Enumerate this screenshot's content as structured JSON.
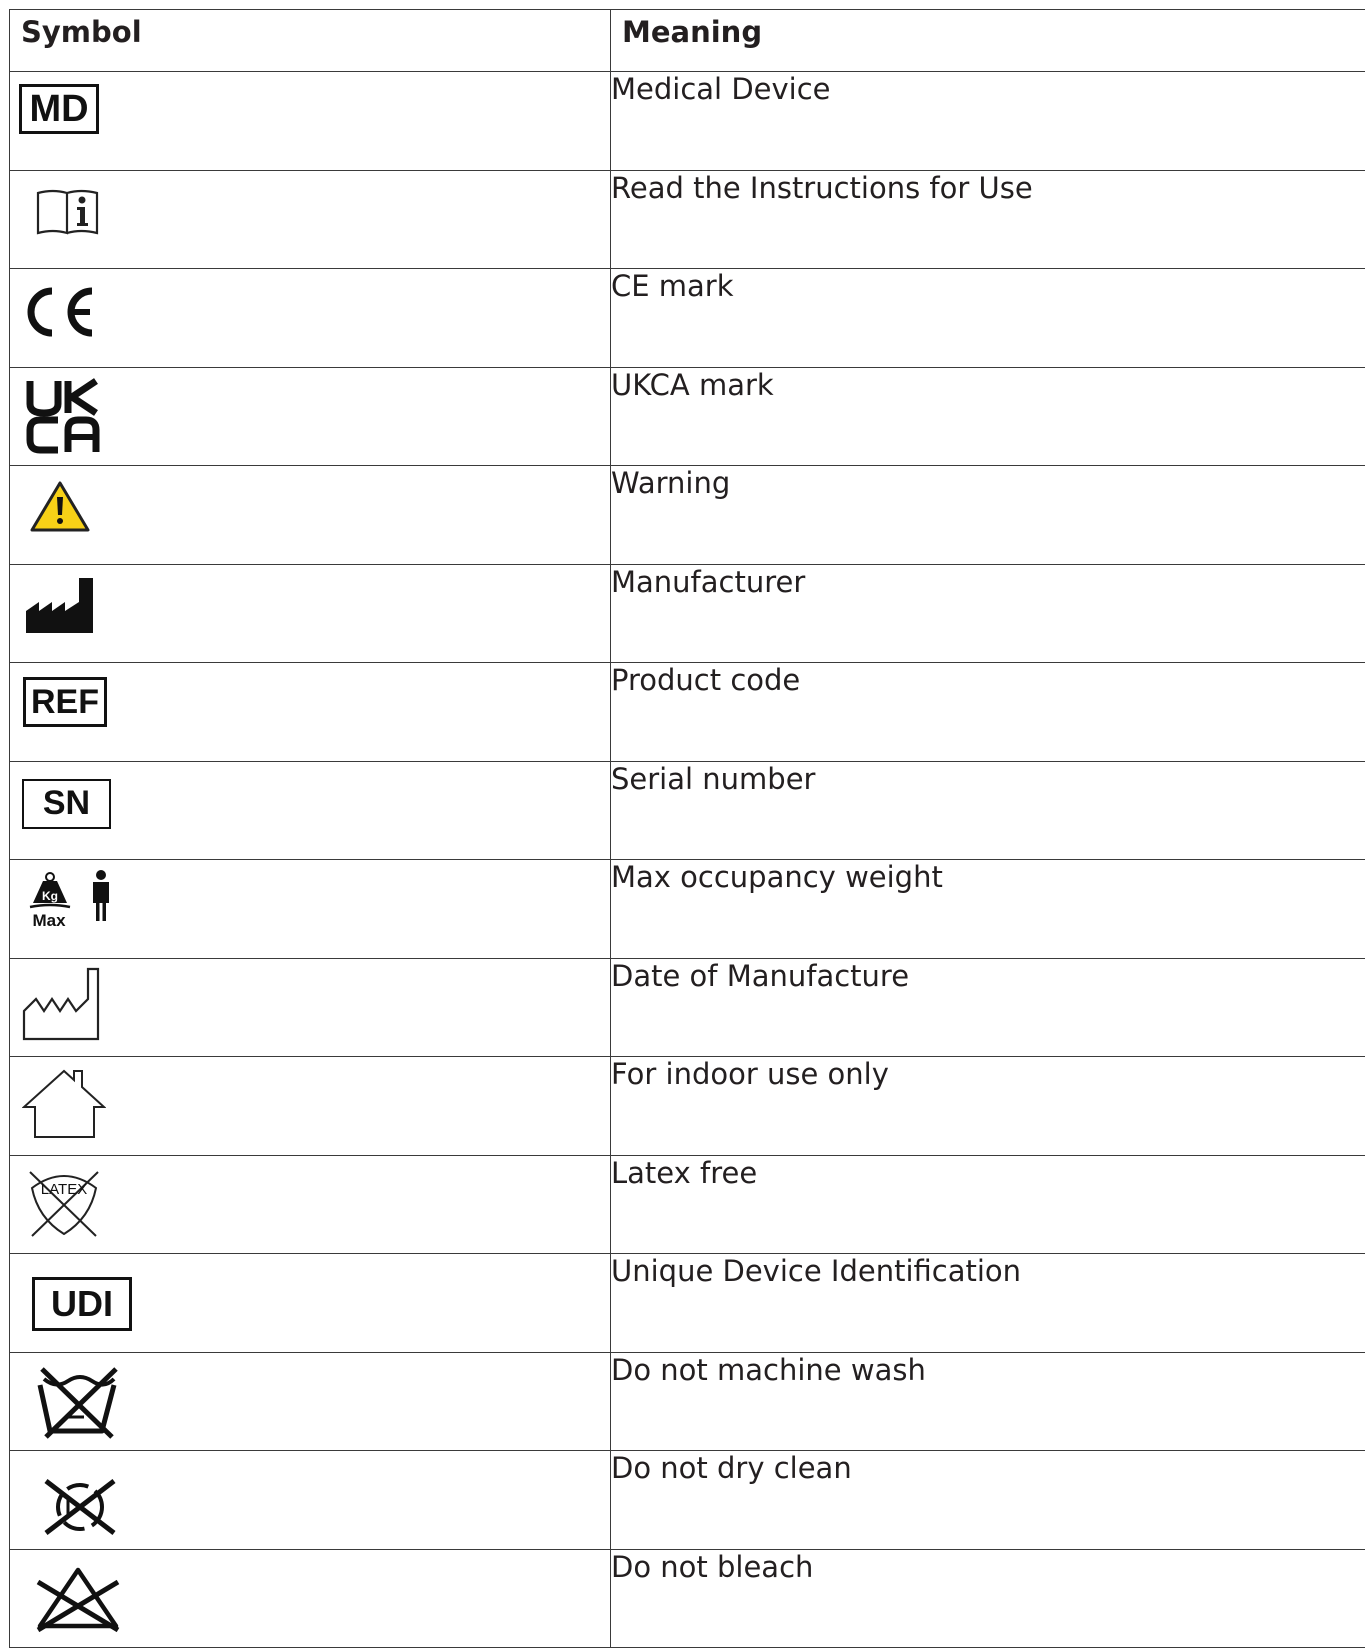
{
  "header": {
    "symbol": "Symbol",
    "meaning": "Meaning"
  },
  "rows": [
    {
      "icon": "md-box-icon",
      "label": "MD",
      "meaning": "Medical Device"
    },
    {
      "icon": "instructions-book-icon",
      "meaning": "Read the Instructions for Use"
    },
    {
      "icon": "ce-mark-icon",
      "meaning": "CE mark"
    },
    {
      "icon": "ukca-mark-icon",
      "meaning": "UKCA mark"
    },
    {
      "icon": "warning-triangle-icon",
      "meaning": "Warning"
    },
    {
      "icon": "factory-filled-icon",
      "meaning": "Manufacturer"
    },
    {
      "icon": "ref-box-icon",
      "label": "REF",
      "meaning": "Product code"
    },
    {
      "icon": "sn-box-icon",
      "label": "SN",
      "meaning": "Serial number"
    },
    {
      "icon": "max-weight-person-icon",
      "label_kg": "Kg",
      "label_max": "Max",
      "meaning": "Max occupancy weight"
    },
    {
      "icon": "factory-outline-icon",
      "meaning": "Date of Manufacture"
    },
    {
      "icon": "house-icon",
      "meaning": "For indoor use only"
    },
    {
      "icon": "latex-free-icon",
      "label": "LATEX",
      "meaning": "Latex free"
    },
    {
      "icon": "udi-box-icon",
      "label": "UDI",
      "meaning": "Unique Device Identification"
    },
    {
      "icon": "no-machine-wash-icon",
      "meaning": "Do not machine wash"
    },
    {
      "icon": "no-dry-clean-icon",
      "meaning": "Do not dry clean"
    },
    {
      "icon": "no-bleach-icon",
      "meaning": "Do not bleach"
    }
  ],
  "colors": {
    "warning_yellow": "#f7d117",
    "ink": "#111111"
  }
}
